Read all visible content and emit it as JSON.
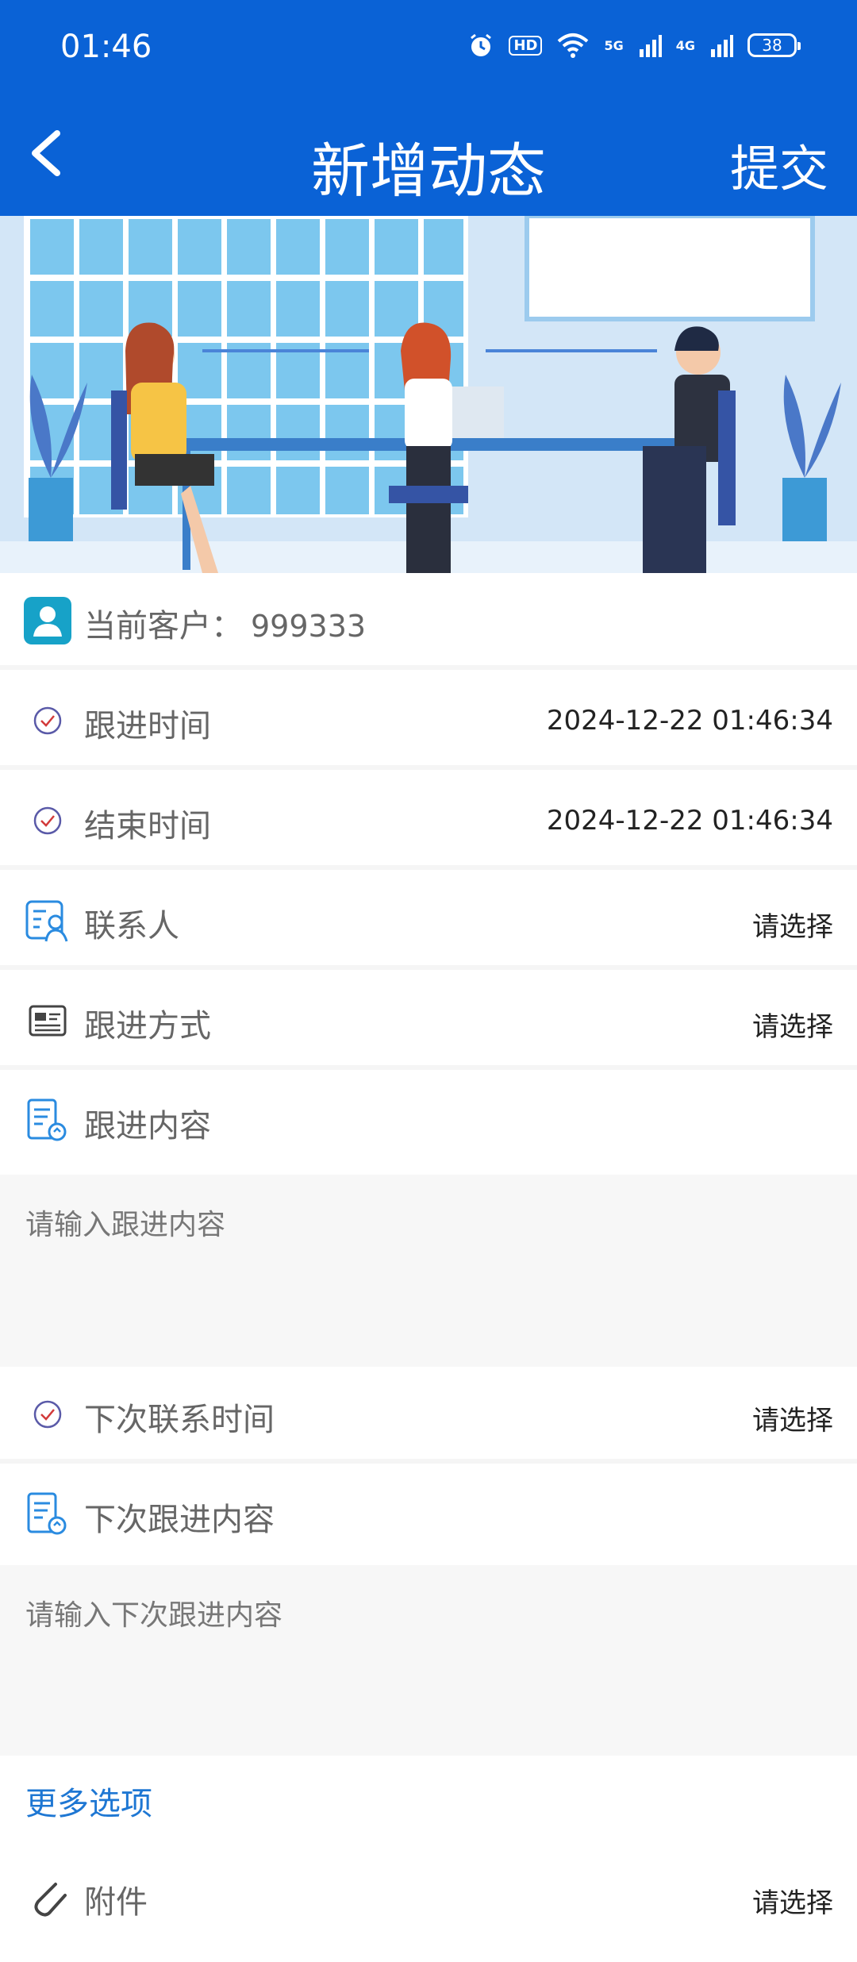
{
  "status": {
    "time": "01:46",
    "battery": "38",
    "net1": "5G",
    "net2": "4G",
    "hd": "HD"
  },
  "header": {
    "title": "新增动态",
    "submit_label": "提交"
  },
  "customer": {
    "label": "当前客户：",
    "value": "999333"
  },
  "fields": {
    "follow_time": {
      "label": "跟进时间",
      "value": "2024-12-22 01:46:34"
    },
    "end_time": {
      "label": "结束时间",
      "value": "2024-12-22 01:46:34"
    },
    "contact": {
      "label": "联系人",
      "value": "请选择"
    },
    "method": {
      "label": "跟进方式",
      "value": "请选择"
    },
    "content": {
      "label": "跟进内容",
      "placeholder": "请输入跟进内容"
    },
    "next_time": {
      "label": "下次联系时间",
      "value": "请选择"
    },
    "next_content": {
      "label": "下次跟进内容",
      "placeholder": "请输入下次跟进内容"
    },
    "attachment": {
      "label": "附件",
      "value": "请选择"
    }
  },
  "more_options_label": "更多选项",
  "colors": {
    "brand": "#0a62d6",
    "link": "#1e77d3",
    "icon_blue": "#2a8be0",
    "icon_cyan": "#17a2c8"
  }
}
